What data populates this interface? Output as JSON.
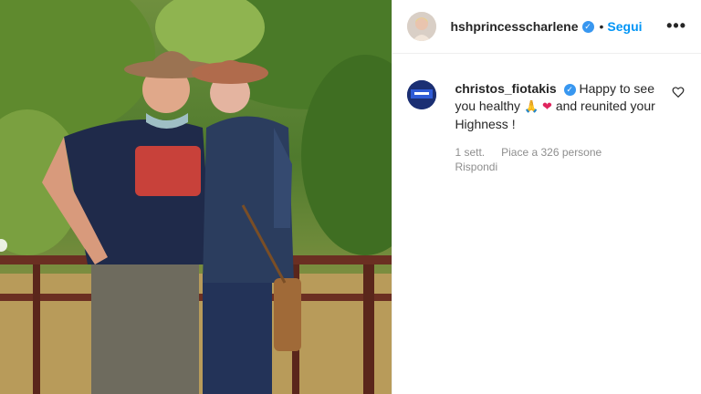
{
  "header": {
    "username": "hshprincesscharlene",
    "separator": "•",
    "follow_label": "Segui",
    "more_label": "•••"
  },
  "comment": {
    "username": "christos_fiotakis",
    "text_part1": "Happy to see you healthy",
    "emoji_pray": "🙏",
    "emoji_heart": "❤",
    "text_part2": "and reunited your Highness !",
    "time": "1 sett.",
    "likes": "Piace a 326 persone",
    "reply_label": "Rispondi"
  },
  "colors": {
    "accent": "#0095f6",
    "verified": "#3897f0",
    "text": "#262626",
    "muted": "#8e8e8e"
  },
  "icons": {
    "verified": "verified-badge-icon",
    "like": "heart-outline-icon",
    "more": "more-options-icon"
  }
}
